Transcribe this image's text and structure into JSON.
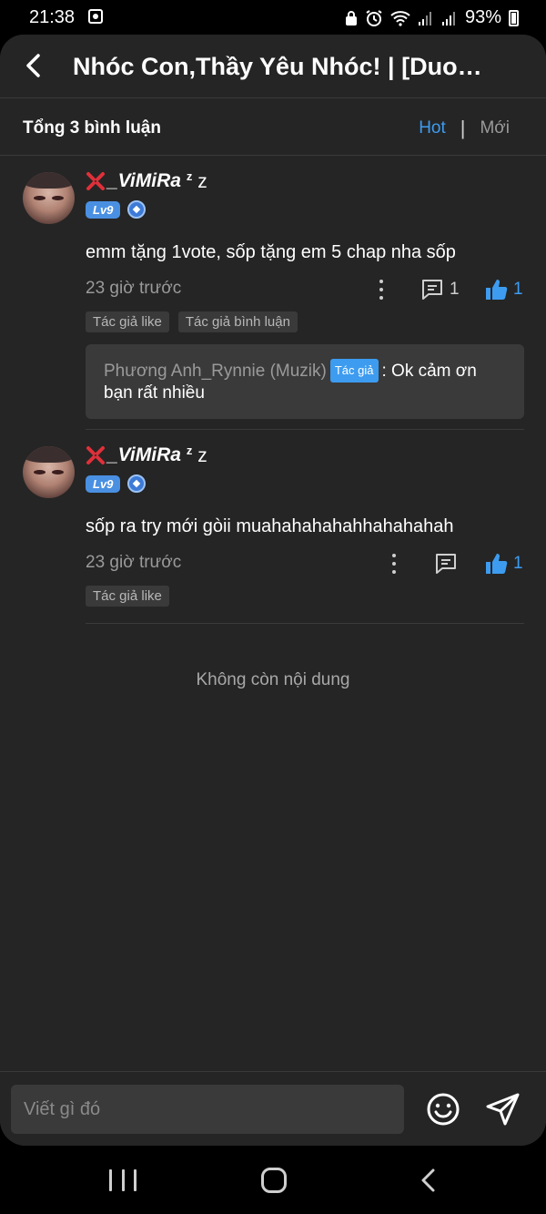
{
  "status_bar": {
    "time": "21:38",
    "battery": "93%"
  },
  "header": {
    "title": "Nhóc Con,Thầy Yêu Nhóc! | [Duong..."
  },
  "subheader": {
    "comment_count": "Tổng 3 bình luận",
    "sort_hot": "Hot",
    "sort_sep": "|",
    "sort_new": "Mới"
  },
  "comments": [
    {
      "username": "_ViMiRa",
      "suffix_sup": "z",
      "suffix": "z",
      "level": "Lv9",
      "text": "emm tặng 1vote, sốp tặng em 5 chap nha sốp",
      "time": "23 giờ trước",
      "reply_count": "1",
      "like_count": "1",
      "tags": [
        "Tác giả like",
        "Tác giả bình luận"
      ],
      "reply": {
        "author": "Phương Anh_Rynnie (Muzik)",
        "author_tag": "Tác giả",
        "text": ": Ok cảm ơn bạn rất nhiều"
      }
    },
    {
      "username": "_ViMiRa",
      "suffix_sup": "z",
      "suffix": "z",
      "level": "Lv9",
      "text": "sốp ra try mới gòii muahahahahahhahahahah",
      "time": "23 giờ trước",
      "like_count": "1",
      "tags": [
        "Tác giả like"
      ]
    }
  ],
  "end_message": "Không còn nội dung",
  "composer": {
    "placeholder": "Viết gì đó"
  },
  "colors": {
    "accent": "#3d9cf0",
    "background": "#252525",
    "card": "#3a3a3a"
  }
}
